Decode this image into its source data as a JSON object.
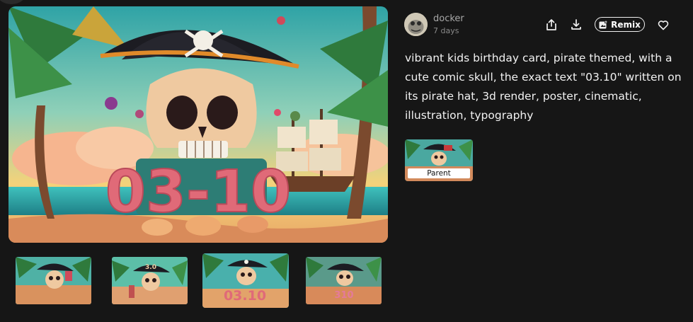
{
  "author": {
    "username": "docker",
    "time_ago": "7 days"
  },
  "actions": {
    "share_icon": "share-icon",
    "download_icon": "download-icon",
    "remix_label": "Remix",
    "like_icon": "heart-icon"
  },
  "prompt": "vibrant kids birthday card, pirate themed, with a cute comic skull, the exact text \"03.10\" written on its pirate hat, 3d render, poster, cinematic, illustration, typography",
  "main_image": {
    "number_text": "03-10"
  },
  "thumbnails": [
    {
      "label": "",
      "active": false
    },
    {
      "label": "3.0",
      "active": false
    },
    {
      "label": "03.10",
      "active": true
    },
    {
      "label": "310",
      "active": false
    }
  ],
  "parent": {
    "label": "Parent"
  },
  "colors": {
    "background": "#161616",
    "sky_teal": "#3fb6b0",
    "sky_yellow": "#f2c94c",
    "hat_black": "#1c1c22",
    "skull": "#efc9a0",
    "number_pink": "#e06a78"
  }
}
